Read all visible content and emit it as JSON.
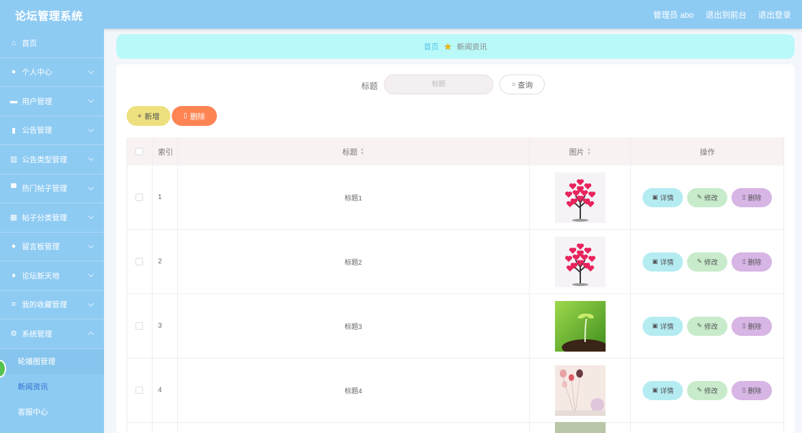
{
  "app": {
    "title": "论坛管理系统"
  },
  "header": {
    "admin": "管理员 abo",
    "backend": "退出到前台",
    "logout": "退出登录"
  },
  "sidebar": {
    "items": [
      {
        "label": "首页",
        "icon": "home-icon",
        "glyph": "⌂",
        "chevron": false
      },
      {
        "label": "个人中心",
        "icon": "user-icon",
        "glyph": "●",
        "chevron": true
      },
      {
        "label": "用户管理",
        "icon": "users-icon",
        "glyph": "▬",
        "chevron": true
      },
      {
        "label": "公告管理",
        "icon": "notice-icon",
        "glyph": "▮",
        "chevron": true
      },
      {
        "label": "公告类型管理",
        "icon": "bar-chart-icon",
        "glyph": "▥",
        "chevron": true
      },
      {
        "label": "热门帖子管理",
        "icon": "post-icon",
        "glyph": "▀",
        "chevron": true
      },
      {
        "label": "帖子分类管理",
        "icon": "grid-icon",
        "glyph": "▦",
        "chevron": true
      },
      {
        "label": "留言板管理",
        "icon": "user-message-icon",
        "glyph": "●",
        "chevron": true
      },
      {
        "label": "论坛新天地",
        "icon": "microphone-icon",
        "glyph": "♦",
        "chevron": true
      },
      {
        "label": "我的收藏管理",
        "icon": "list-icon",
        "glyph": "≡",
        "chevron": true
      },
      {
        "label": "系统管理",
        "icon": "gear-icon",
        "glyph": "⚙",
        "chevron": "up"
      }
    ],
    "subitems": [
      "轮播图管理",
      "新闻资讯",
      "客服中心"
    ],
    "active_sub": "新闻资讯"
  },
  "breadcrumb": {
    "home": "首页",
    "current": "新闻资讯"
  },
  "search": {
    "label": "标题",
    "placeholder": "标题",
    "button": "查询"
  },
  "toolbar": {
    "add_label": "新增",
    "delete_label": "删除"
  },
  "table": {
    "headers": {
      "index": "索引",
      "title": "标题",
      "image": "图片",
      "ops": "操作"
    },
    "rows": [
      {
        "index": "1",
        "title": "标题1",
        "image": "heart-tree"
      },
      {
        "index": "2",
        "title": "标题2",
        "image": "heart-tree"
      },
      {
        "index": "3",
        "title": "标题3",
        "image": "sprout"
      },
      {
        "index": "4",
        "title": "标题4",
        "image": "balloons"
      }
    ],
    "ops": {
      "detail": "详情",
      "edit": "修改",
      "remove": "删除"
    }
  },
  "colors": {
    "sidebar": "#8ecbf3",
    "breadcrumb": "#baf9f9",
    "add": "#ede07e",
    "delete": "#fe8453",
    "detail": "#b4ecf2",
    "edit": "#c7ebcb",
    "remove": "#d7b5e5"
  }
}
